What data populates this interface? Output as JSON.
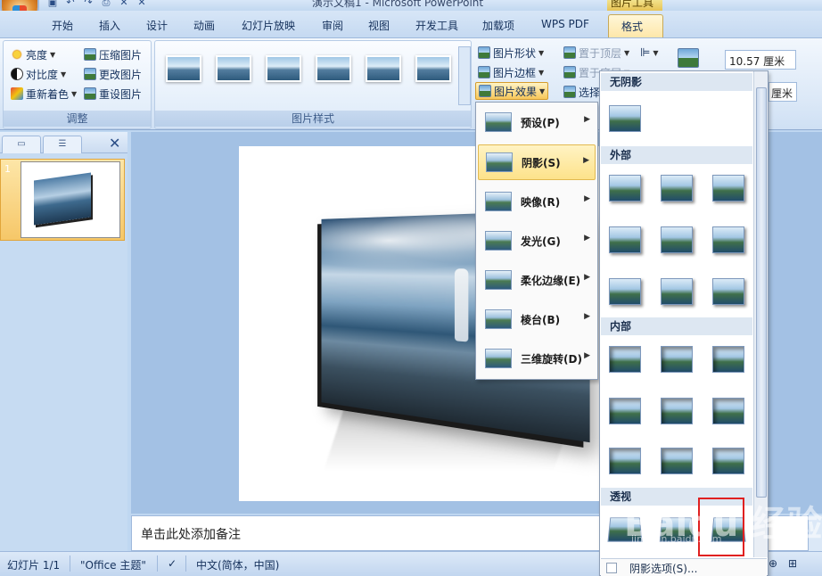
{
  "window": {
    "title": "演示文稿1 - Microsoft PowerPoint",
    "context_tab_group": "图片工具"
  },
  "tabs": [
    "开始",
    "插入",
    "设计",
    "动画",
    "幻灯片放映",
    "审阅",
    "视图",
    "开发工具",
    "加载项",
    "WPS PDF",
    "格式"
  ],
  "active_tab": "格式",
  "ribbon": {
    "adjust": {
      "label": "调整",
      "brightness": "亮度",
      "contrast": "对比度",
      "recolor": "重新着色",
      "compress": "压缩图片",
      "change_picture": "更改图片",
      "reset_picture": "重设图片"
    },
    "picture_styles": {
      "label": "图片样式"
    },
    "picture_shape": "图片形状",
    "picture_border": "图片边框",
    "picture_effects": "图片效果",
    "bring_to_front": "置于顶层",
    "send_to_back": "置于底层",
    "selection_pane": "选择",
    "height_value": "10.57 厘米",
    "width_unit": "厘米"
  },
  "slides_pane": {
    "slide_number": "1"
  },
  "notes_placeholder": "单击此处添加备注",
  "effects_menu": {
    "items": [
      {
        "label": "预设(P)"
      },
      {
        "label": "阴影(S)"
      },
      {
        "label": "映像(R)"
      },
      {
        "label": "发光(G)"
      },
      {
        "label": "柔化边缘(E)"
      },
      {
        "label": "棱台(B)"
      },
      {
        "label": "三维旋转(D)"
      }
    ],
    "highlighted": "阴影(S)"
  },
  "shadow_gallery": {
    "sections": [
      "无阴影",
      "外部",
      "内部",
      "透视"
    ],
    "footer": "阴影选项(S)..."
  },
  "status": {
    "slide": "幻灯片 1/1",
    "theme": "\"Office 主题\"",
    "language": "中文(简体，中国)"
  },
  "watermark": {
    "main": "Baidu 经验",
    "sub": "jingyan.baidu.com"
  },
  "colors": {
    "accent_highlight": "#fde28a",
    "ribbon_bg": "#dbe8f7",
    "selection_box": "#e02020"
  }
}
